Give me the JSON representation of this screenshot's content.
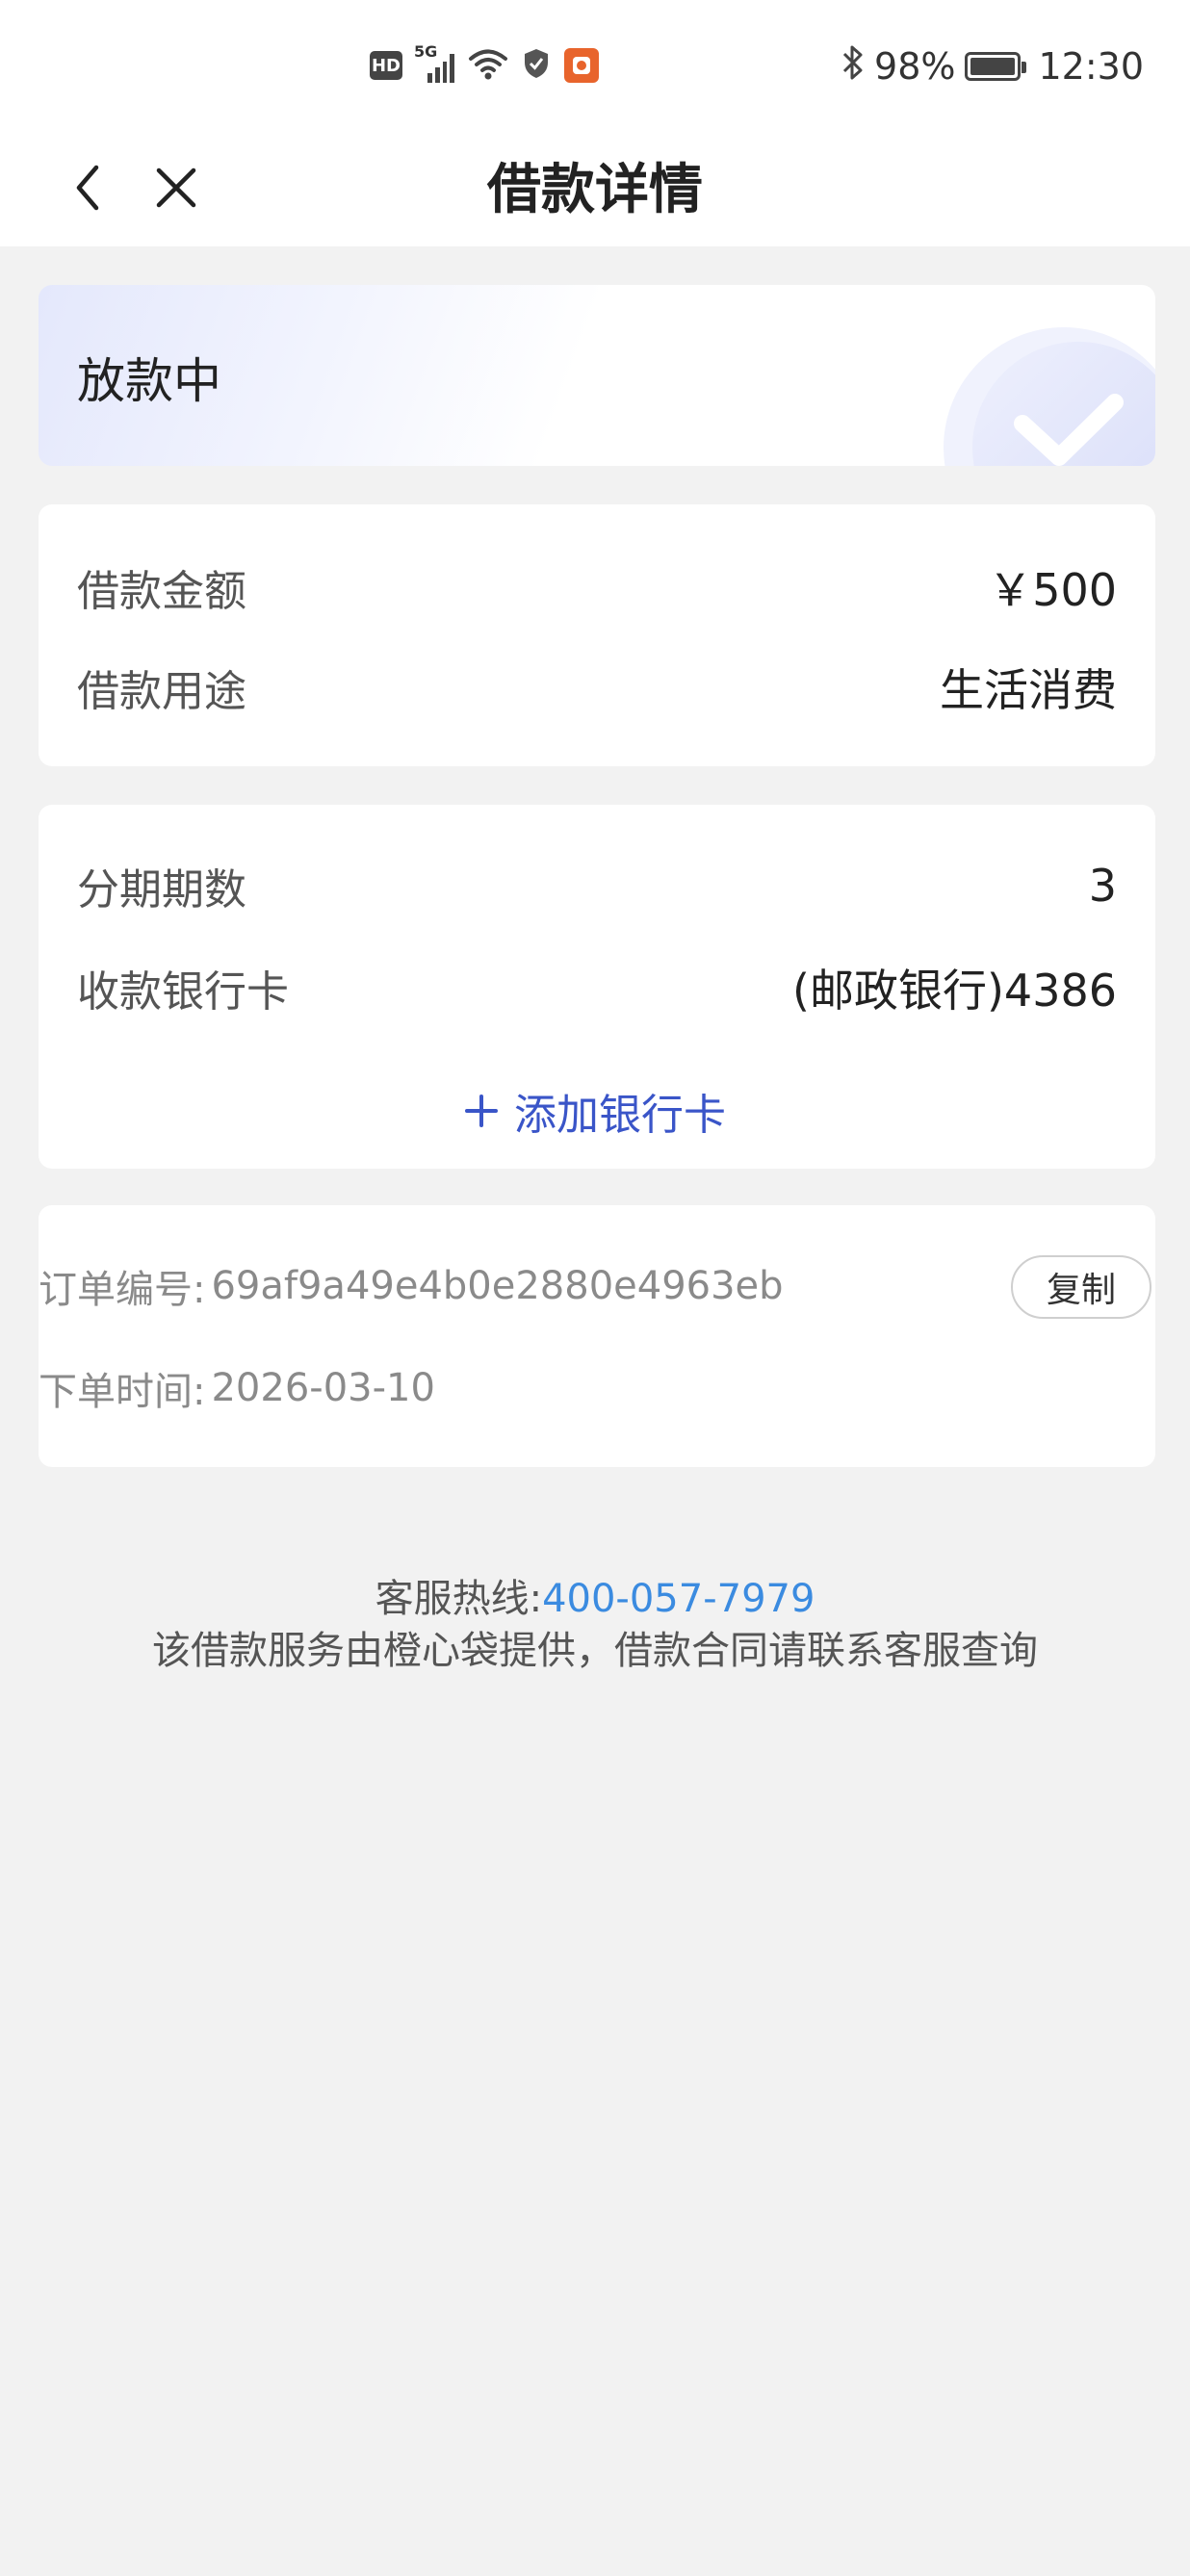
{
  "status_bar": {
    "hd": "HD",
    "network": "5G",
    "battery_percent": "98%",
    "battery_level": 0.98,
    "time": "12:30",
    "icons": [
      "hd-icon",
      "signal-icon",
      "wifi-icon",
      "shield-icon",
      "app-notification-icon",
      "bluetooth-icon",
      "battery-icon"
    ]
  },
  "nav": {
    "title": "借款详情",
    "back_icon": "back-arrow-icon",
    "close_icon": "close-icon"
  },
  "status_card": {
    "status": "放款中",
    "icon": "check-icon",
    "accent": "#e4e8fc"
  },
  "loan_info": {
    "amount_label": "借款金额",
    "amount_value": "￥500",
    "purpose_label": "借款用途",
    "purpose_value": "生活消费"
  },
  "installment_info": {
    "periods_label": "分期期数",
    "periods_value": "3",
    "bank_label": "收款银行卡",
    "bank_value": "(邮政银行)4386",
    "add_card_label": "添加银行卡",
    "add_card_icon": "plus-icon",
    "accent": "#3a55c8"
  },
  "order_info": {
    "order_no_label": "订单编号:",
    "order_no_value": "69af9a49e4b0e2880e4963eb",
    "copy_button": "复制",
    "order_time_label": "下单时间:",
    "order_time_value": "2026-03-10"
  },
  "footer": {
    "hotline_label": "客服热线:",
    "hotline_number": "400-057-7979",
    "note": "该借款服务由橙心袋提供，借款合同请联系客服查询",
    "link_color": "#3b8be0"
  }
}
